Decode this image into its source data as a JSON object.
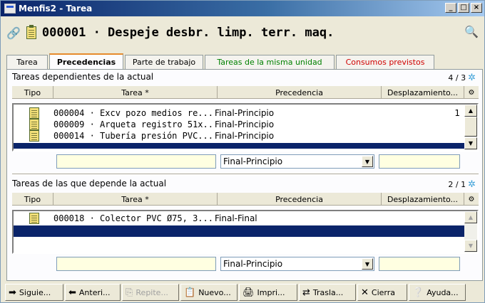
{
  "window": {
    "title": "Menfis2 - Tarea",
    "controls": {
      "minimize": "_",
      "maximize": "□",
      "close": "×"
    }
  },
  "header": {
    "link_icon": "🔗",
    "task_code": "000001 · Despeje desbr. limp. terr. maq.",
    "search_icon": "🔍"
  },
  "tabs": [
    {
      "label": "Tarea"
    },
    {
      "label": "Precedencias"
    },
    {
      "label": "Parte de trabajo"
    },
    {
      "label": "Tareas de la misma unidad"
    },
    {
      "label": "Consumos previstos"
    }
  ],
  "colors": {
    "tab_green": "#008000",
    "tab_red": "#d00000",
    "selection": "#0a246a"
  },
  "dependents": {
    "label": "Tareas dependientes de la actual",
    "count": "4 / 3",
    "columns": [
      "Tipo",
      "Tarea *",
      "Precedencia",
      "Desplazamiento..."
    ],
    "rows": [
      {
        "tarea": "000004 · Excv pozo medios re...",
        "precedencia": "Final-Principio",
        "desplazamiento": "1"
      },
      {
        "tarea": "000009 · Arqueta registro 51x...",
        "precedencia": "Final-Principio",
        "desplazamiento": ""
      },
      {
        "tarea": "000014 · Tubería presión PVC...",
        "precedencia": "Final-Principio",
        "desplazamiento": ""
      }
    ],
    "edit": {
      "tarea": "",
      "precedencia": "Final-Principio",
      "desplazamiento": ""
    }
  },
  "depends_on": {
    "label": "Tareas de las que depende la actual",
    "count": "2 / 1",
    "columns": [
      "Tipo",
      "Tarea *",
      "Precedencia",
      "Desplazamiento..."
    ],
    "rows": [
      {
        "tarea": "000018 · Colector PVC Ø75, 3...",
        "precedencia": "Final-Final",
        "desplazamiento": ""
      }
    ],
    "edit": {
      "tarea": "",
      "precedencia": "Final-Principio",
      "desplazamiento": ""
    }
  },
  "toolbar": [
    {
      "label": "Siguie...",
      "icon": "➡"
    },
    {
      "label": "Anteri...",
      "icon": "⬅"
    },
    {
      "label": "Repite...",
      "icon": "⎘"
    },
    {
      "label": "Nuevo...",
      "icon": "📋"
    },
    {
      "label": "Impri...",
      "icon": "🖨"
    },
    {
      "label": "Trasla...",
      "icon": "⇄"
    },
    {
      "label": "Cierra",
      "icon": "✕"
    },
    {
      "label": "Ayuda...",
      "icon": "❔"
    }
  ]
}
